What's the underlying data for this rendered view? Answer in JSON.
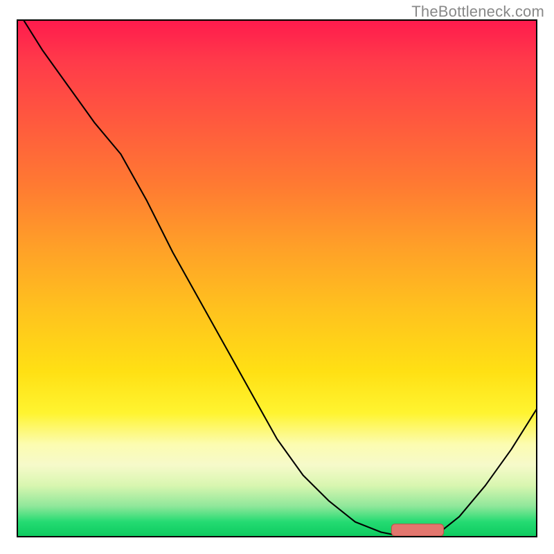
{
  "watermark": "TheBottleneck.com",
  "colors": {
    "curve": "#000000",
    "marker_fill": "#e2766e",
    "marker_stroke": "#c44d47",
    "frame": "#000000"
  },
  "chart_data": {
    "type": "line",
    "title": "",
    "xlabel": "",
    "ylabel": "",
    "xlim": [
      0,
      100
    ],
    "ylim": [
      0,
      100
    ],
    "grid": false,
    "legend": false,
    "x": [
      0,
      5,
      10,
      15,
      20,
      25,
      30,
      35,
      40,
      45,
      50,
      55,
      60,
      65,
      70,
      75,
      80,
      85,
      90,
      95,
      100
    ],
    "values": [
      102,
      94,
      87,
      80,
      74,
      65,
      55,
      46,
      37,
      28,
      19,
      12,
      7,
      3,
      1,
      0,
      0,
      4,
      10,
      17,
      25
    ],
    "notes": "Values are percentage-style readings off the vertical axis of the heat-gradient chart; the curve descends from the top-left, levels out near 0 around x≈74–80, then rises toward the right. A short highlighted optimal-range marker sits on the baseline roughly at x≈72–82.",
    "marker_range_x": [
      72,
      82
    ],
    "marker_height_pct": 1.5
  }
}
